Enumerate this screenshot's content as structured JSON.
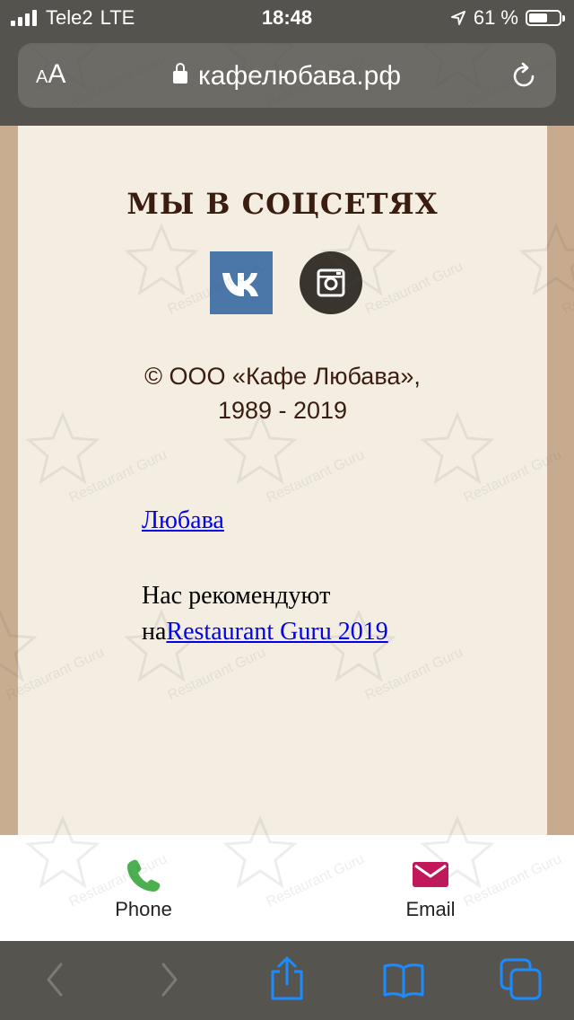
{
  "status_bar": {
    "carrier": "Tele2",
    "network": "LTE",
    "time": "18:48",
    "battery_percent": "61 %",
    "battery_level": 0.61
  },
  "address_bar": {
    "text_size_label": "AA",
    "url": "кафелюбава.рф",
    "icons": [
      "lock-icon",
      "reload-icon"
    ]
  },
  "page": {
    "social_heading": "МЫ В СОЦСЕТЯХ",
    "social_links": [
      {
        "name": "VK",
        "icon": "vk-icon",
        "color": "#4a76a8"
      },
      {
        "name": "Instagram",
        "icon": "instagram-icon",
        "color": "#3a342e"
      }
    ],
    "copyright_line1": "© ООО «Кафе Любава»,",
    "copyright_line2": "1989 - 2019",
    "link_lyubava": "Любава",
    "recommend_text": "Нас рекомендуют",
    "recommend_prefix": "на",
    "recommend_link": "Restaurant Guru 2019"
  },
  "contact_bar": {
    "phone_label": "Phone",
    "email_label": "Email",
    "phone_color": "#4caf50",
    "email_color": "#c2185b"
  },
  "toolbar": {
    "icons": [
      "back-icon",
      "forward-icon",
      "share-icon",
      "bookmarks-icon",
      "tabs-icon"
    ],
    "accent": "#1a8cff"
  },
  "watermark": "Restaurant Guru"
}
